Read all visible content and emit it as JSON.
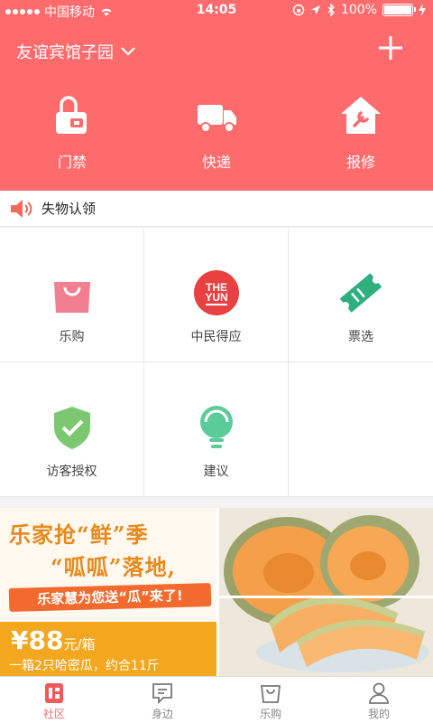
{
  "status_bar": {
    "carrier": "中国移动",
    "time": "14:05",
    "battery": "100%",
    "battery_level": 1.0
  },
  "header": {
    "location": "友谊宾馆子园",
    "quick_actions": [
      {
        "label": "门禁",
        "icon": "door-access-icon"
      },
      {
        "label": "快递",
        "icon": "truck-icon"
      },
      {
        "label": "报修",
        "icon": "house-repair-icon"
      }
    ]
  },
  "notice": {
    "text": "失物认领",
    "icon": "speaker-icon"
  },
  "grid": {
    "items": [
      {
        "label": "乐购",
        "icon": "shopping-bag-icon"
      },
      {
        "label": "中民得应",
        "icon": "theyun-logo-icon",
        "logo_text": [
          "THE",
          "YUN"
        ]
      },
      {
        "label": "票选",
        "icon": "ticket-icon"
      },
      {
        "label": "访客授权",
        "icon": "shield-check-icon"
      },
      {
        "label": "建议",
        "icon": "lightbulb-icon"
      }
    ]
  },
  "banner": {
    "title_line1": "乐家抢“鲜”季",
    "title_line2": "“呱呱”落地,",
    "slogan": "乐家慧为您送“瓜”来了!",
    "price": "¥88",
    "price_unit": "元/箱",
    "description": "一箱2只哈密瓜，约合11斤"
  },
  "tabs": [
    {
      "label": "社区",
      "icon": "community-icon",
      "active": true
    },
    {
      "label": "身边",
      "icon": "message-icon",
      "active": false
    },
    {
      "label": "乐购",
      "icon": "shopping-bag-icon",
      "active": false
    },
    {
      "label": "我的",
      "icon": "user-icon",
      "active": false
    }
  ],
  "colors": {
    "brand": "#fd6b6d",
    "accent_orange": "#f3a71f",
    "tab_active": "#fd6b6d"
  }
}
